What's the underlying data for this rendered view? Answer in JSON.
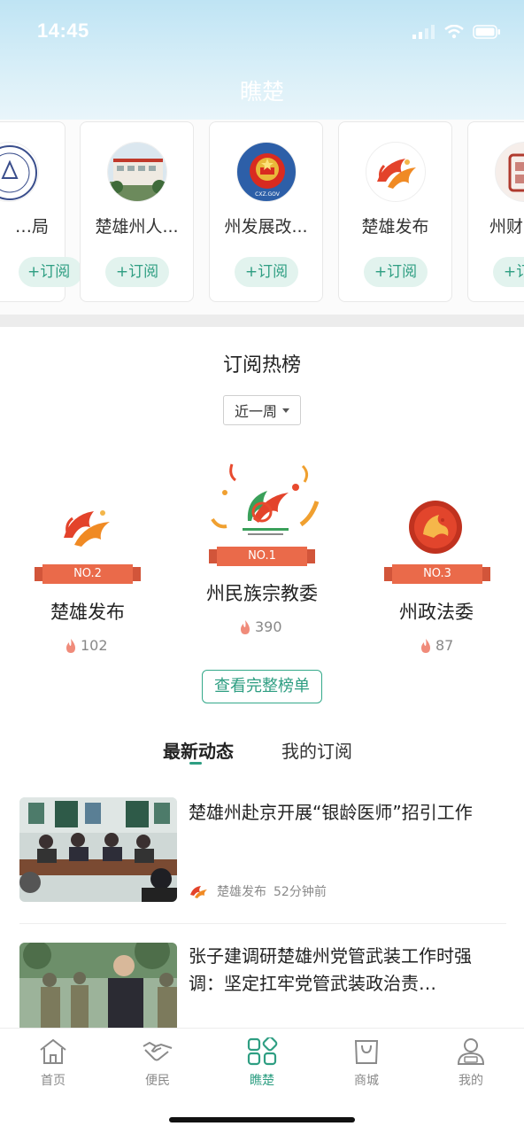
{
  "status_bar": {
    "time": "14:45"
  },
  "header": {
    "title": "瞧楚"
  },
  "subscription_cards": [
    {
      "name": "…局",
      "button": "+订阅",
      "icon": "partial-seal-logo"
    },
    {
      "name": "楚雄州人...",
      "button": "+订阅",
      "icon": "hospital-building-photo"
    },
    {
      "name": "州发展改...",
      "button": "+订阅",
      "icon": "national-emblem-logo"
    },
    {
      "name": "楚雄发布",
      "button": "+订阅",
      "icon": "chuxiong-fabu-logo"
    },
    {
      "name": "州财",
      "button": "+订阅",
      "icon": "partial-finance-logo"
    }
  ],
  "ranking": {
    "title": "订阅热榜",
    "period": "近一周",
    "items": [
      {
        "rank": "NO.1",
        "name": "州民族宗教委",
        "heat": "390"
      },
      {
        "rank": "NO.2",
        "name": "楚雄发布",
        "heat": "102"
      },
      {
        "rank": "NO.3",
        "name": "州政法委",
        "heat": "87"
      }
    ],
    "full_list_button": "查看完整榜单"
  },
  "feed_tabs": [
    {
      "label": "最新动态",
      "active": true
    },
    {
      "label": "我的订阅",
      "active": false
    }
  ],
  "news": [
    {
      "title": "楚雄州赴京开展“银龄医师”招引工作",
      "source": "楚雄发布",
      "time": "52分钟前"
    },
    {
      "title": "张子建调研楚雄州党管武装工作时强调：坚定扛牢党管武装政治责…"
    }
  ],
  "bottom_nav": [
    {
      "label": "首页",
      "icon": "home-icon"
    },
    {
      "label": "便民",
      "icon": "handshake-icon"
    },
    {
      "label": "瞧楚",
      "icon": "grid-icon",
      "active": true
    },
    {
      "label": "商城",
      "icon": "shopping-bag-icon"
    },
    {
      "label": "我的",
      "icon": "profile-icon"
    }
  ],
  "colors": {
    "accent": "#2e9e82",
    "ribbon": "#ea6a4a",
    "header_gradient_top": "#bfe4f4"
  }
}
